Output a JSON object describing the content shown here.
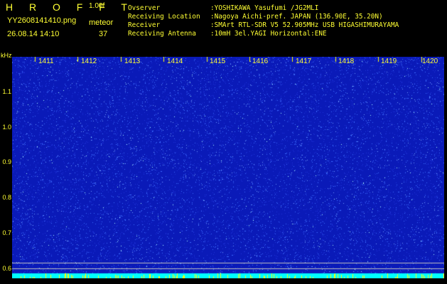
{
  "header": {
    "title": "H R O F F T",
    "version": "1.00f",
    "file_name": "YY2608141410.png",
    "mode": "meteor",
    "datetime": "26.08.14 14:10",
    "count": "37"
  },
  "station_info": [
    {
      "key": "Ovserver",
      "value": ":YOSHIKAWA Yasufumi /JG2MLI"
    },
    {
      "key": "Receiving Location",
      "value": ":Nagoya Aichi-pref. JAPAN (136.90E, 35.20N)"
    },
    {
      "key": "Receiver",
      "value": ":SMArt RTL-SDR V5 52.905MHz USB HIGASHIMURAYAMA"
    },
    {
      "key": "Receiving Antenna",
      "value": ":10mH 3el.YAGI Horizontal:ENE"
    }
  ],
  "waterfall": {
    "y_unit": "kHz",
    "y_ticks": [
      "1.1",
      "1.0",
      "0.9",
      "0.8",
      "0.7",
      "0.6"
    ],
    "y_range": [
      0.58,
      1.2
    ],
    "x_ticks": [
      "1411",
      "1412",
      "1413",
      "1414",
      "1415",
      "1416",
      "1417",
      "1418",
      "1419",
      "1420"
    ],
    "colors": {
      "background": "#0a1ab8",
      "noise": "#3a6aff",
      "bright": "#aaffff",
      "baseline": "#00ffff",
      "marker": "#ffff00",
      "ref_line": "#c0c0c0"
    }
  }
}
